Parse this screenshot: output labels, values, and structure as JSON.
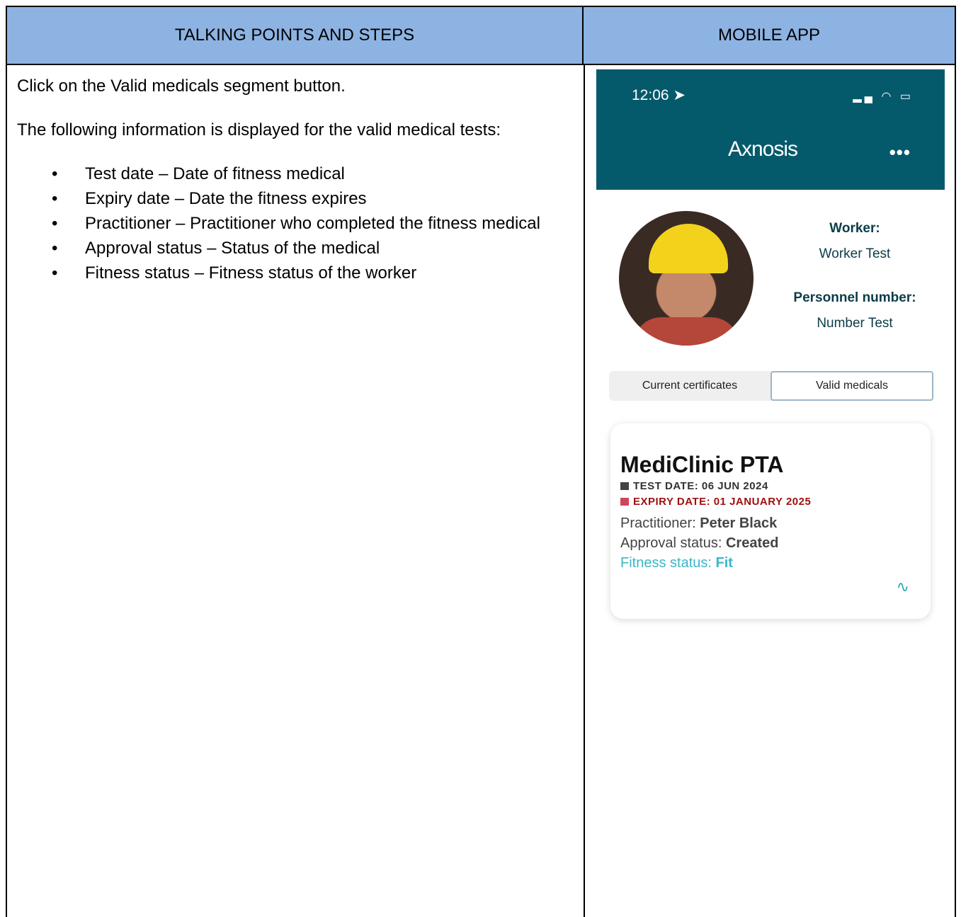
{
  "headers": {
    "left": "TALKING POINTS AND STEPS",
    "right": "MOBILE APP"
  },
  "intro": {
    "pre": "Click on the ",
    "bold": "Valid medicals",
    "post": " segment button."
  },
  "lead": "The following information is displayed for the valid medical tests:",
  "bullets": [
    {
      "term": "Test date –",
      "desc": " Date of fitness medical"
    },
    {
      "term": "Expiry date –",
      "desc": " Date the fitness expires"
    },
    {
      "term": "Practitioner",
      "desc": " – Practitioner who completed the fitness medical"
    },
    {
      "term": "Approval status –",
      "desc": " Status of the medical"
    },
    {
      "term": "Fitness status –",
      "desc": " Fitness status of the worker"
    }
  ],
  "app": {
    "time": "12:06",
    "logo": "Axnosis",
    "worker_label": "Worker:",
    "worker_value": "Worker Test",
    "personnel_label": "Personnel number:",
    "personnel_value": "Number Test",
    "segments": [
      "Current certificates",
      "Valid medicals"
    ],
    "selected_segment": "Valid medicals",
    "card": {
      "clinic": "MediClinic PTA",
      "test_date": "TEST DATE: 06 JUN 2024",
      "expiry_date": "EXPIRY DATE: 01 JANUARY 2025",
      "practitioner_label": "Practitioner:",
      "practitioner_value": "Peter Black",
      "approval_label": "Approval status:",
      "approval_value": "Created",
      "fitness_label": "Fitness status:",
      "fitness_value": "Fit"
    },
    "colors": {
      "topbar": "#045a6b",
      "expiry": "#a01010",
      "fitness": "#3bb6c7"
    }
  }
}
